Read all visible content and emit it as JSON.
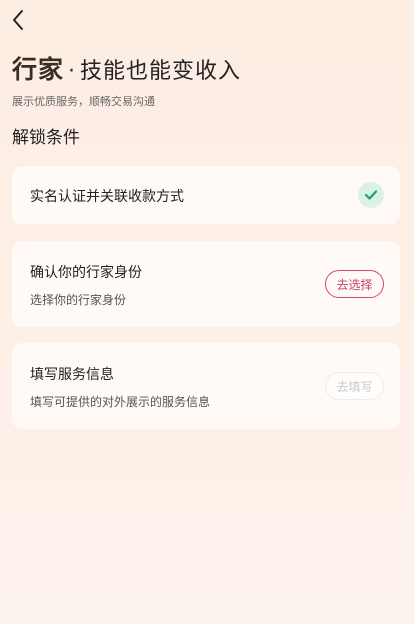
{
  "nav": {
    "back_icon": "chevron-left-icon"
  },
  "header": {
    "brand": "行家",
    "separator": "·",
    "slogan": "技能也能变收入",
    "subtitle": "展示优质服务，顺畅交易沟通"
  },
  "section": {
    "title": "解锁条件"
  },
  "cards": [
    {
      "title": "实名认证并关联收款方式",
      "status_icon": "check-icon",
      "completed": true
    },
    {
      "title": "确认你的行家身份",
      "description": "选择你的行家身份",
      "button_label": "去选择",
      "enabled": true
    },
    {
      "title": "填写服务信息",
      "description": "填写可提供的对外展示的服务信息",
      "button_label": "去填写",
      "enabled": false
    }
  ],
  "colors": {
    "background": "#fdeee4",
    "accent": "#d9486a",
    "success": "#1aa36a",
    "success_bg": "#d9f1e6",
    "disabled": "#c9c9c9"
  }
}
